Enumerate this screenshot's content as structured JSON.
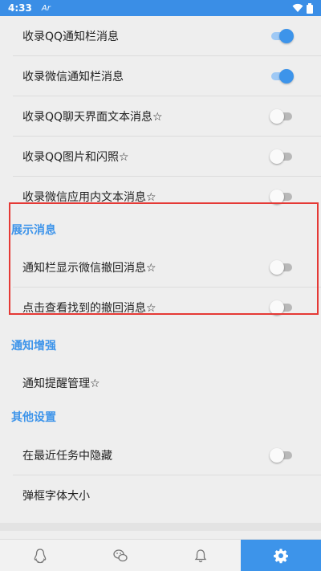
{
  "status_bar": {
    "time": "4:33",
    "app_indicator": "Ar"
  },
  "settings": {
    "rows_top": [
      {
        "label": "收录QQ通知栏消息",
        "enabled": true
      },
      {
        "label": "收录微信通知栏消息",
        "enabled": true
      },
      {
        "label": "收录QQ聊天界面文本消息☆",
        "enabled": false
      },
      {
        "label": "收录QQ图片和闪照☆",
        "enabled": false
      },
      {
        "label": "收录微信应用内文本消息☆",
        "enabled": false
      }
    ],
    "section_display": {
      "title": "展示消息",
      "rows": [
        {
          "label": "通知栏显示微信撤回消息☆",
          "enabled": false
        },
        {
          "label": "点击查看找到的撤回消息☆",
          "enabled": false
        }
      ]
    },
    "section_notify": {
      "title": "通知增强",
      "rows": [
        {
          "label": "通知提醒管理☆"
        }
      ]
    },
    "section_other": {
      "title": "其他设置",
      "rows": [
        {
          "label": "在最近任务中隐藏",
          "enabled": false
        },
        {
          "label": "弹框字体大小"
        }
      ]
    }
  },
  "bottom_nav": [
    {
      "icon": "qq-penguin-icon",
      "active": false
    },
    {
      "icon": "wechat-icon",
      "active": false
    },
    {
      "icon": "bell-icon",
      "active": false
    },
    {
      "icon": "gear-icon",
      "active": true
    }
  ],
  "colors": {
    "accent": "#3d94ea",
    "highlight_border": "#e53935",
    "status_bar": "#3a8ee6"
  }
}
